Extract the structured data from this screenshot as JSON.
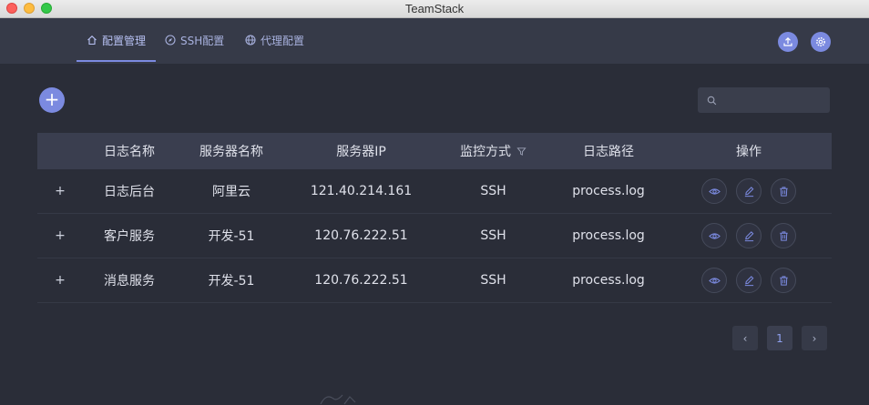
{
  "window": {
    "title": "TeamStack"
  },
  "nav": {
    "tabs": [
      {
        "label": "配置管理",
        "icon": "home-icon",
        "active": true
      },
      {
        "label": "SSH配置",
        "icon": "compass-icon",
        "active": false
      },
      {
        "label": "代理配置",
        "icon": "globe-icon",
        "active": false
      }
    ],
    "right_icons": [
      "upload-icon",
      "gear-icon"
    ]
  },
  "toolbar": {
    "add_label": "+",
    "search_placeholder": ""
  },
  "table": {
    "columns": [
      "",
      "日志名称",
      "服务器名称",
      "服务器IP",
      "监控方式",
      "日志路径",
      "操作"
    ],
    "rows": [
      {
        "expand": "+",
        "name": "日志后台",
        "server": "阿里云",
        "ip": "121.40.214.161",
        "method": "SSH",
        "path": "process.log"
      },
      {
        "expand": "+",
        "name": "客户服务",
        "server": "开发-51",
        "ip": "120.76.222.51",
        "method": "SSH",
        "path": "process.log"
      },
      {
        "expand": "+",
        "name": "消息服务",
        "server": "开发-51",
        "ip": "120.76.222.51",
        "method": "SSH",
        "path": "process.log"
      }
    ],
    "row_actions": [
      "eye-icon",
      "edit-icon",
      "trash-icon"
    ]
  },
  "pagination": {
    "prev": "‹",
    "current": "1",
    "next": "›"
  },
  "colors": {
    "accent": "#7b8ae0",
    "background": "#2a2d38",
    "nav": "#363a48",
    "header": "#3a3e4f"
  }
}
